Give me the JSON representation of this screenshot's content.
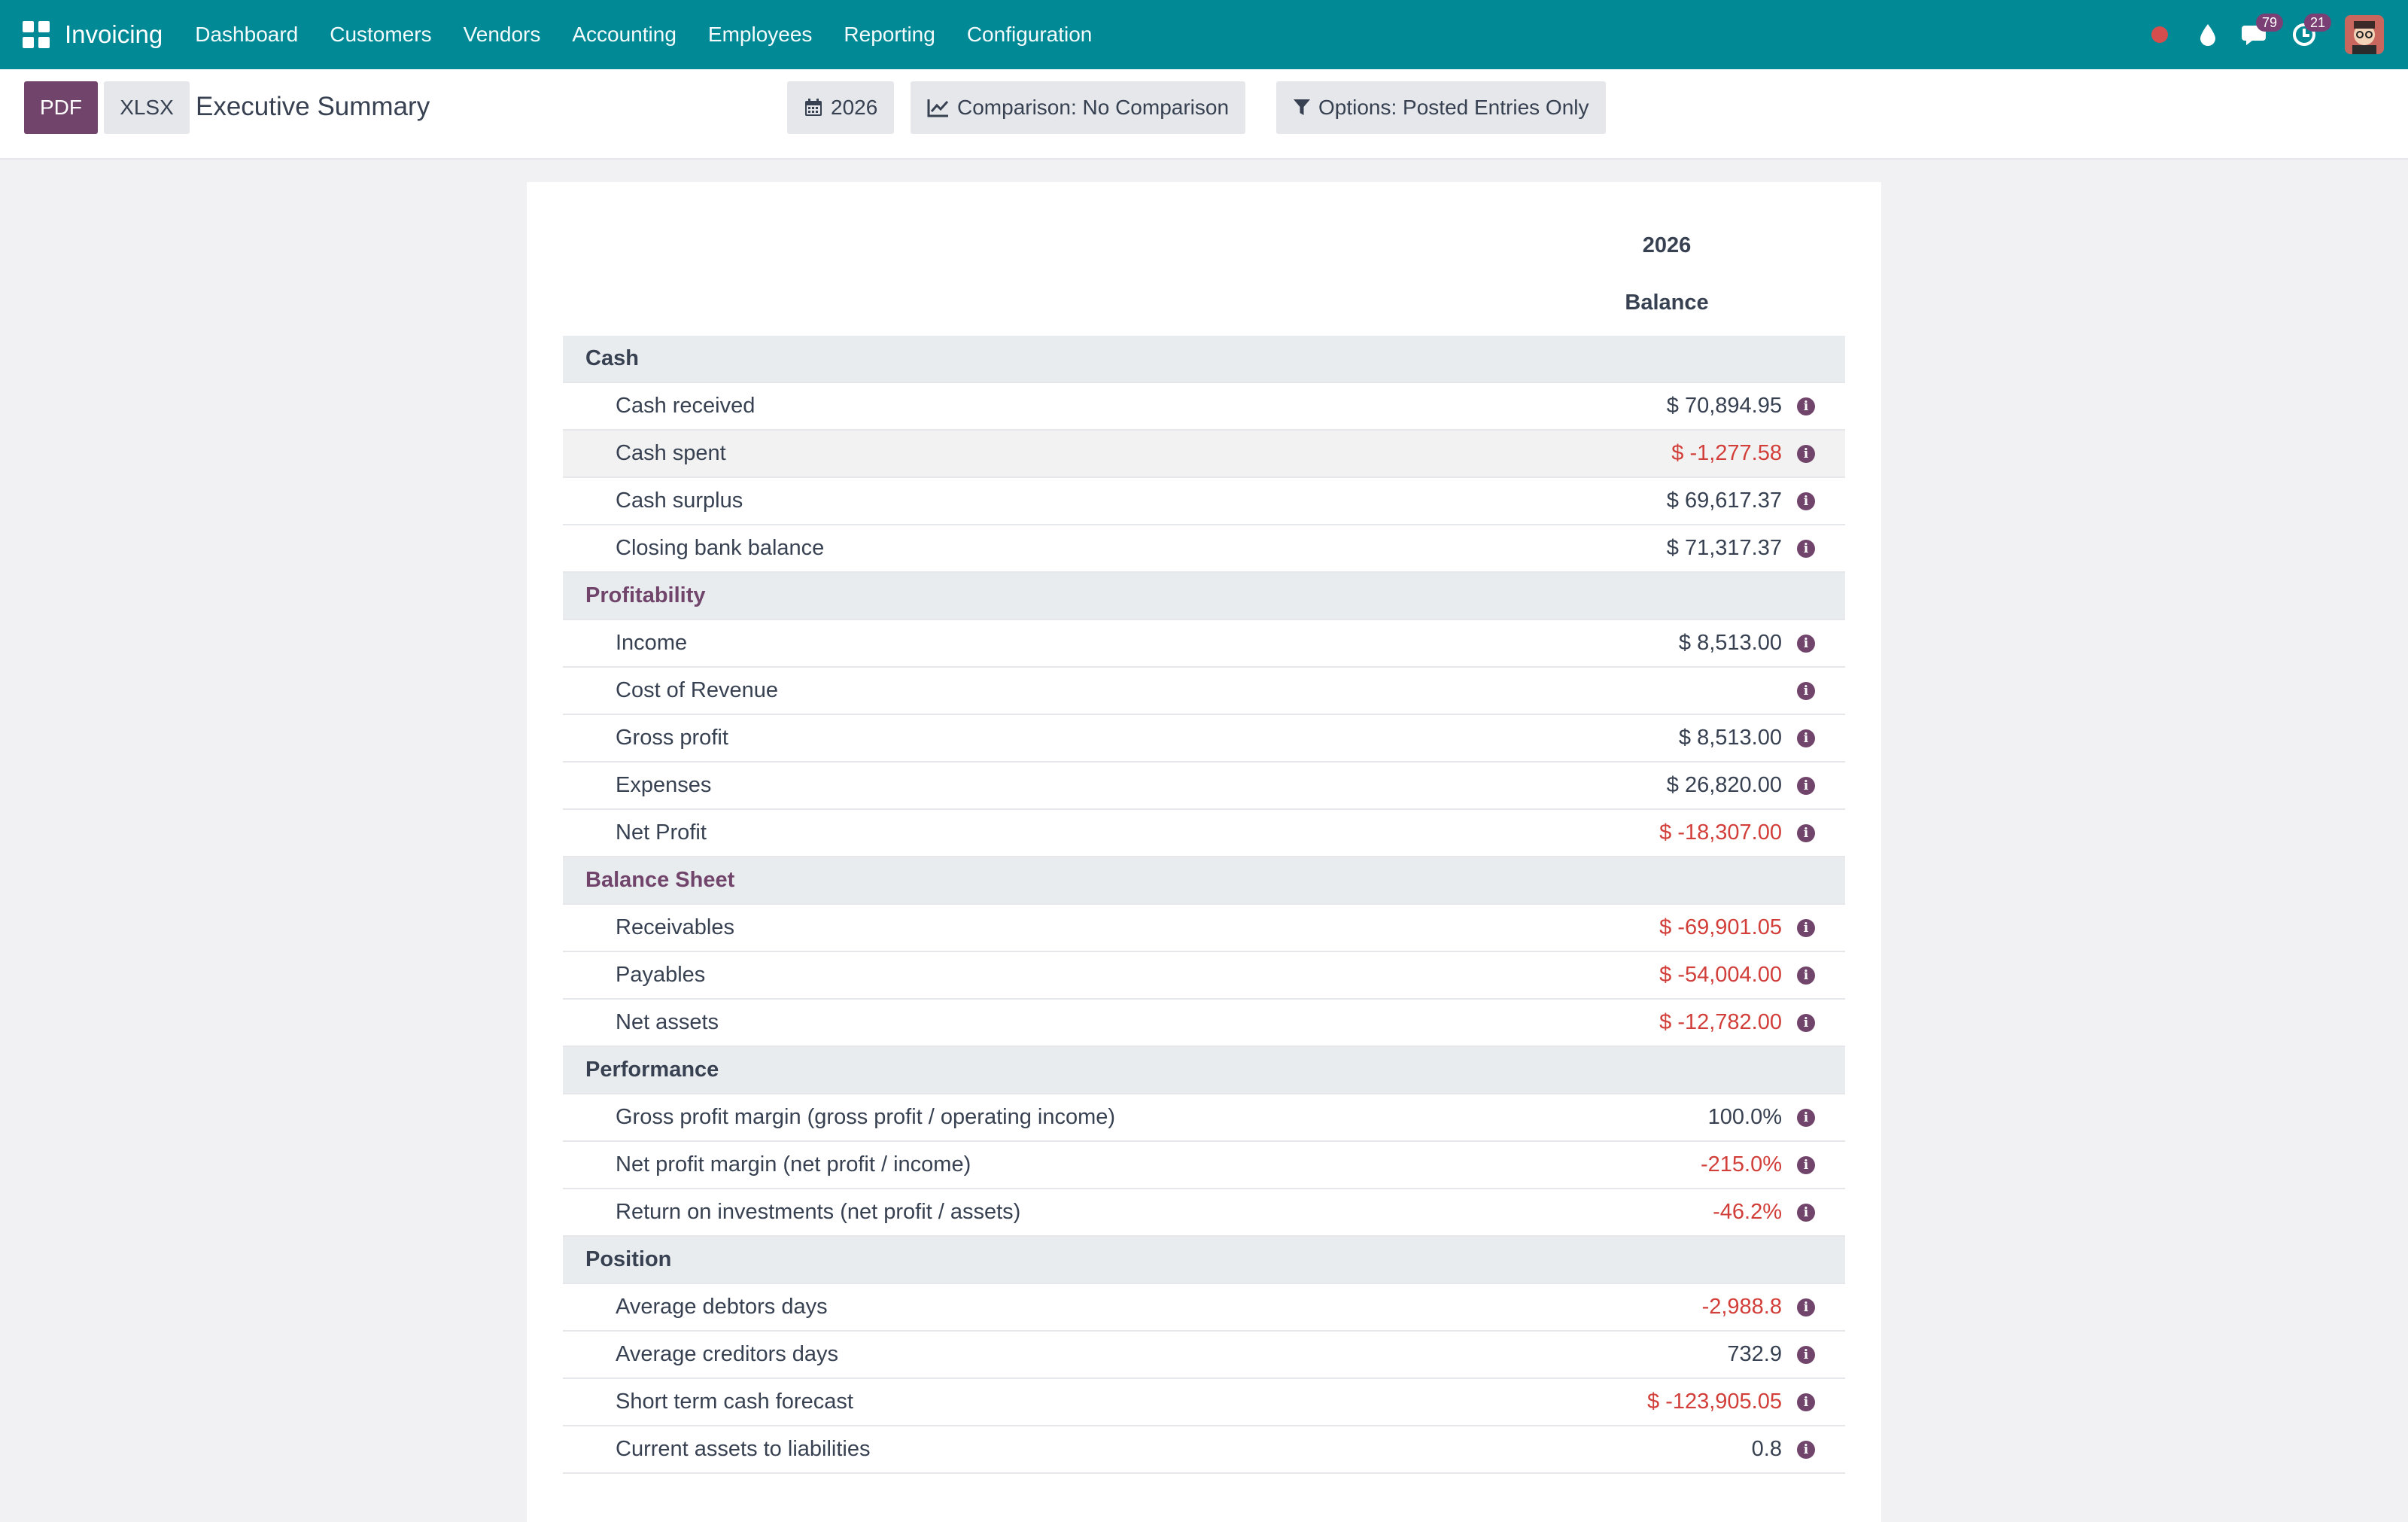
{
  "navbar": {
    "brand": "Invoicing",
    "menu": [
      "Dashboard",
      "Customers",
      "Vendors",
      "Accounting",
      "Employees",
      "Reporting",
      "Configuration"
    ],
    "messages_badge": "79",
    "activities_badge": "21",
    "color": "#018a96"
  },
  "control_panel": {
    "pdf_label": "PDF",
    "xlsx_label": "XLSX",
    "title": "Executive Summary",
    "date_filter": "2026",
    "comparison_filter": "Comparison: No Comparison",
    "options_filter": "Options: Posted Entries Only"
  },
  "report": {
    "column_year": "2026",
    "column_balance": "Balance",
    "sections": [
      {
        "title": "Cash",
        "accent": false,
        "lines": [
          {
            "label": "Cash received",
            "value": "$ 70,894.95",
            "negative": false
          },
          {
            "label": "Cash spent",
            "value": "$ -1,277.58",
            "negative": true
          },
          {
            "label": "Cash surplus",
            "value": "$ 69,617.37",
            "negative": false
          },
          {
            "label": "Closing bank balance",
            "value": "$ 71,317.37",
            "negative": false
          }
        ]
      },
      {
        "title": "Profitability",
        "accent": true,
        "lines": [
          {
            "label": "Income",
            "value": "$ 8,513.00",
            "negative": false
          },
          {
            "label": "Cost of Revenue",
            "value": "",
            "negative": false
          },
          {
            "label": "Gross profit",
            "value": "$ 8,513.00",
            "negative": false
          },
          {
            "label": "Expenses",
            "value": "$ 26,820.00",
            "negative": false
          },
          {
            "label": "Net Profit",
            "value": "$ -18,307.00",
            "negative": true
          }
        ]
      },
      {
        "title": "Balance Sheet",
        "accent": true,
        "lines": [
          {
            "label": "Receivables",
            "value": "$ -69,901.05",
            "negative": true
          },
          {
            "label": "Payables",
            "value": "$ -54,004.00",
            "negative": true
          },
          {
            "label": "Net assets",
            "value": "$ -12,782.00",
            "negative": true
          }
        ]
      },
      {
        "title": "Performance",
        "accent": false,
        "lines": [
          {
            "label": "Gross profit margin (gross profit / operating income)",
            "value": "100.0%",
            "negative": false
          },
          {
            "label": "Net profit margin (net profit / income)",
            "value": "-215.0%",
            "negative": true
          },
          {
            "label": "Return on investments (net profit / assets)",
            "value": "-46.2%",
            "negative": true
          }
        ]
      },
      {
        "title": "Position",
        "accent": false,
        "lines": [
          {
            "label": "Average debtors days",
            "value": "-2,988.8",
            "negative": true
          },
          {
            "label": "Average creditors days",
            "value": "732.9",
            "negative": false
          },
          {
            "label": "Short term cash forecast",
            "value": "$ -123,905.05",
            "negative": true
          },
          {
            "label": "Current assets to liabilities",
            "value": "0.8",
            "negative": false
          }
        ]
      }
    ]
  }
}
